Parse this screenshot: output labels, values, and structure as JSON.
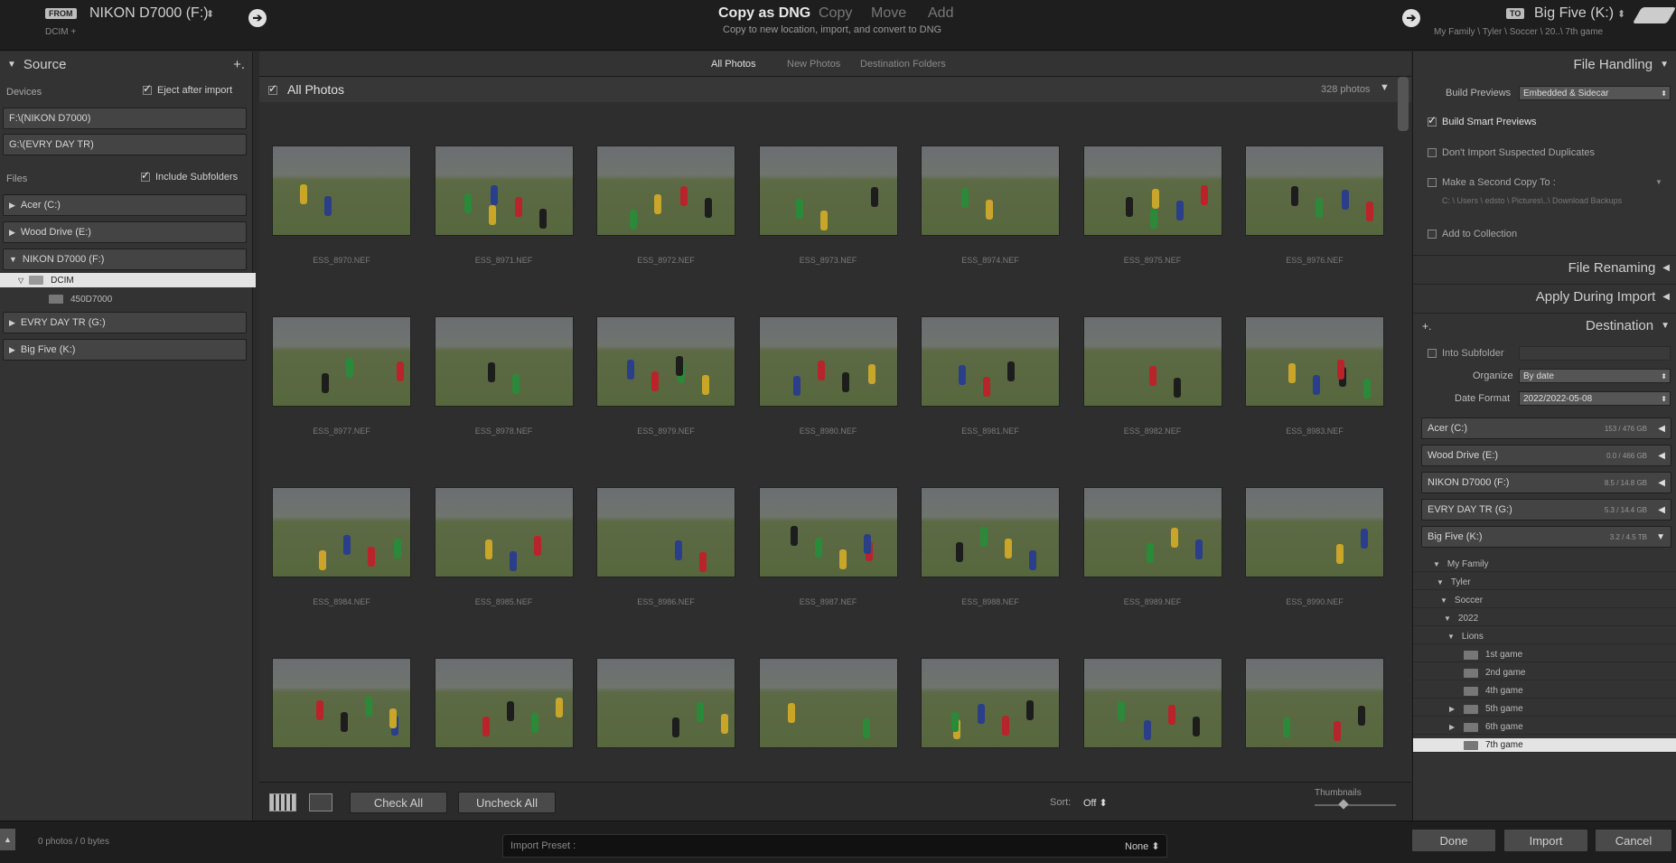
{
  "topbar": {
    "from_badge": "FROM",
    "source_title": "NIKON D7000 (F:)",
    "source_arrow": "⬍",
    "source_sub": "DCIM +",
    "modes": [
      "Copy as DNG",
      "Copy",
      "Move",
      "Add"
    ],
    "mode_desc": "Copy to new location, import, and convert to DNG",
    "to_badge": "TO",
    "dest_title": "Big Five (K:)",
    "dest_arrow": "⬍",
    "dest_path": "My Family \\ Tyler \\ Soccer \\ 20..\\ 7th game"
  },
  "source": {
    "title": "Source",
    "add": "+.",
    "devices_label": "Devices",
    "eject_label": "Eject after import",
    "device_buttons": [
      "F:\\(NIKON D7000)",
      "G:\\(EVRY DAY TR)"
    ],
    "files_label": "Files",
    "subfolders_label": "Include Subfolders",
    "drives": [
      {
        "name": "Acer (C:)",
        "tri": "▶"
      },
      {
        "name": "Wood Drive (E:)",
        "tri": "▶"
      },
      {
        "name": "NIKON D7000 (F:)",
        "tri": "▼"
      }
    ],
    "dcim": "DCIM",
    "subfolder": "450D7000",
    "drives_after": [
      {
        "name": "EVRY DAY TR (G:)",
        "tri": "▶"
      },
      {
        "name": "Big Five (K:)",
        "tri": "▶"
      }
    ]
  },
  "center": {
    "tabs": [
      "All Photos",
      "New Photos",
      "Destination Folders"
    ],
    "grid_title": "All Photos",
    "photo_count": "328 photos",
    "files": [
      "ESS_8970.NEF",
      "ESS_8971.NEF",
      "ESS_8972.NEF",
      "ESS_8973.NEF",
      "ESS_8974.NEF",
      "ESS_8975.NEF",
      "ESS_8976.NEF",
      "ESS_8977.NEF",
      "ESS_8978.NEF",
      "ESS_8979.NEF",
      "ESS_8980.NEF",
      "ESS_8981.NEF",
      "ESS_8982.NEF",
      "ESS_8983.NEF",
      "ESS_8984.NEF",
      "ESS_8985.NEF",
      "ESS_8986.NEF",
      "ESS_8987.NEF",
      "ESS_8988.NEF",
      "ESS_8989.NEF",
      "ESS_8990.NEF",
      "",
      "",
      "",
      "",
      "",
      "",
      ""
    ],
    "check_all": "Check All",
    "uncheck_all": "Uncheck All",
    "sort_label": "Sort:",
    "sort_value": "Off",
    "thumbnails_label": "Thumbnails"
  },
  "right": {
    "file_handling": "File Handling",
    "build_previews_label": "Build Previews",
    "build_previews_value": "Embedded & Sidecar",
    "smart_previews": "Build Smart Previews",
    "no_dupes": "Don't Import Suspected Duplicates",
    "second_copy": "Make a Second Copy To :",
    "second_copy_path": "C: \\ Users \\ edsto \\ Pictures\\..\\ Download Backups",
    "add_collection": "Add to Collection",
    "file_renaming": "File Renaming",
    "apply_during": "Apply During Import",
    "destination": "Destination",
    "into_subfolder": "Into Subfolder",
    "organize_label": "Organize",
    "organize_value": "By date",
    "date_format_label": "Date Format",
    "date_format_value": "2022/2022-05-08",
    "drives": [
      {
        "name": "Acer (C:)",
        "space": "153 / 476 GB"
      },
      {
        "name": "Wood Drive (E:)",
        "space": "0.0 / 466 GB"
      },
      {
        "name": "NIKON D7000 (F:)",
        "space": "8.5 / 14.8 GB"
      },
      {
        "name": "EVRY DAY TR (G:)",
        "space": "5.3 / 14.4 GB"
      },
      {
        "name": "Big Five (K:)",
        "space": "3.2 / 4.5 TB"
      }
    ],
    "tree": [
      "My Family",
      "Tyler",
      "Soccer",
      "2022",
      "Lions"
    ],
    "games": [
      "1st game",
      "2nd game",
      "4th game",
      "5th game",
      "6th game",
      "7th game"
    ]
  },
  "bottom": {
    "status": "0 photos / 0 bytes",
    "preset_label": "Import Preset :",
    "preset_value": "None",
    "done": "Done",
    "import": "Import",
    "cancel": "Cancel"
  }
}
